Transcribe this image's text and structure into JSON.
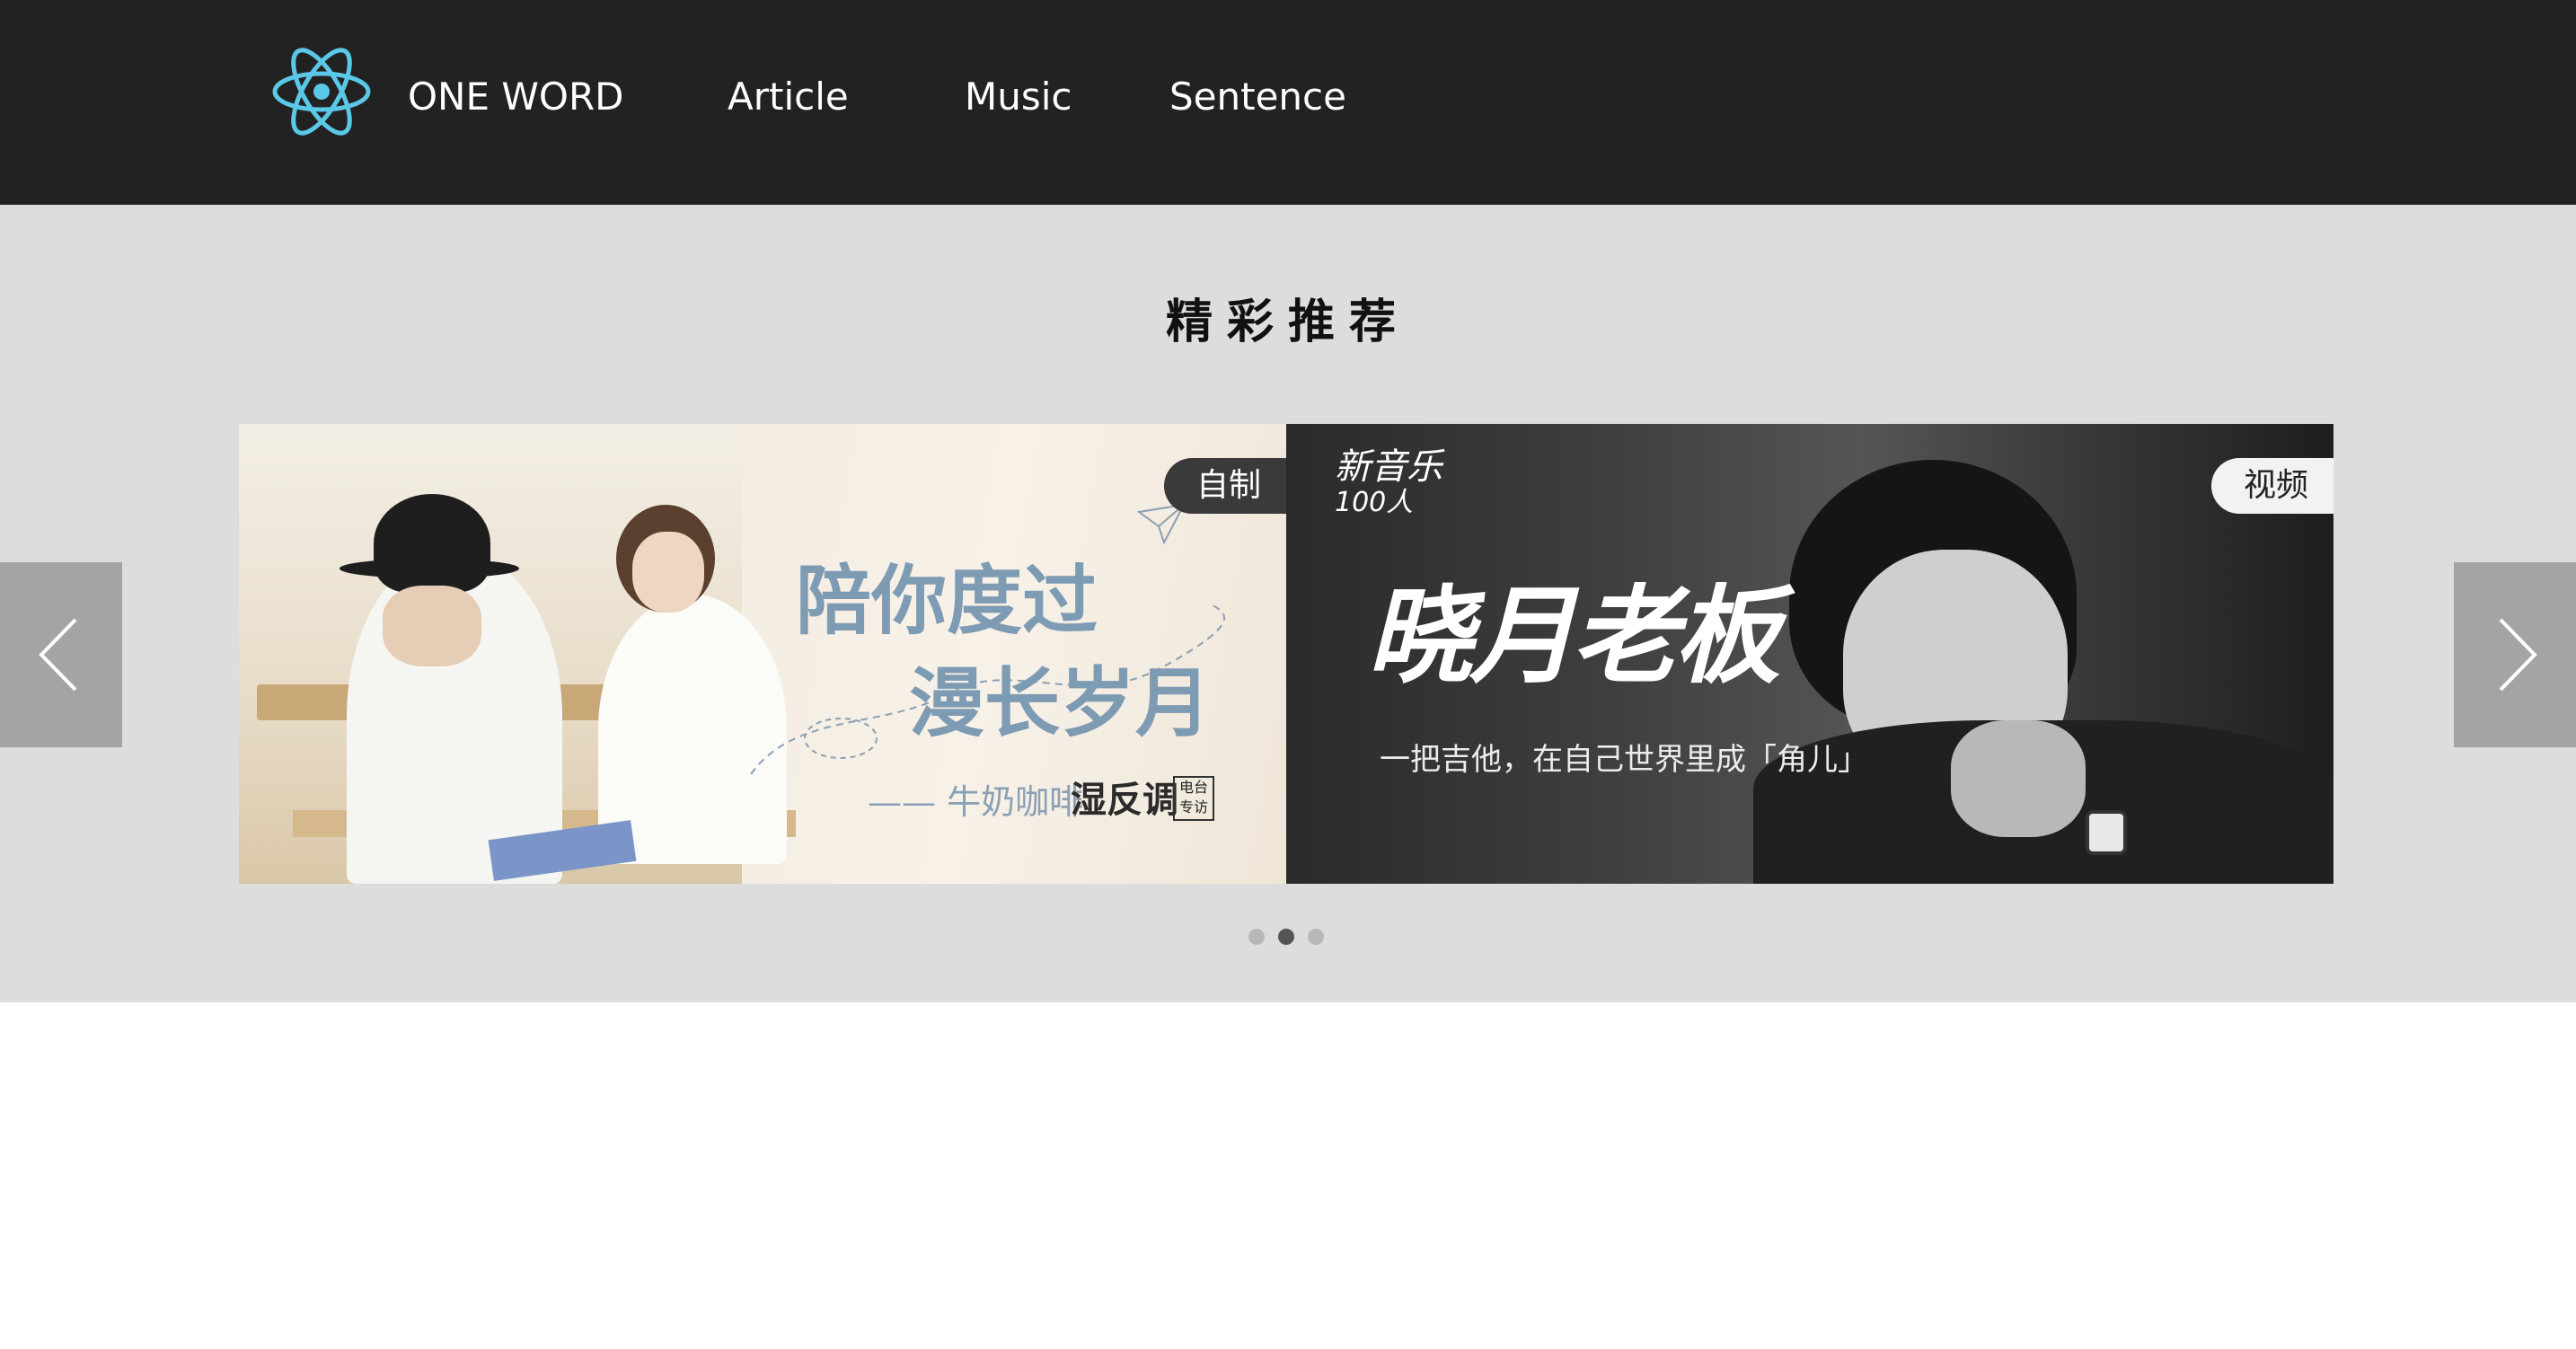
{
  "header": {
    "brand": "ONE WORD",
    "nav": [
      {
        "label": "Article"
      },
      {
        "label": "Music"
      },
      {
        "label": "Sentence"
      }
    ],
    "logo_icon": "atom-icon",
    "logo_color": "#5ac8e6",
    "background": "#222222"
  },
  "section": {
    "title": "精彩推荐",
    "background": "#dddddd"
  },
  "carousel": {
    "slides": [
      {
        "tag": "自制",
        "heading_line1": "陪你度过",
        "heading_line2": "漫长岁月",
        "subtitle": "—— 牛奶咖啡",
        "brand": "湿反调",
        "badge": "电台专访"
      },
      {
        "tag": "视频",
        "logo_line1": "新音乐",
        "logo_line2": "100人",
        "title": "晓月老板",
        "subtitle": "一把吉他，在自己世界里成「角儿」"
      }
    ],
    "prev_icon": "chevron-left-icon",
    "next_icon": "chevron-right-icon",
    "active_dot": 2,
    "dot_count": 3
  }
}
